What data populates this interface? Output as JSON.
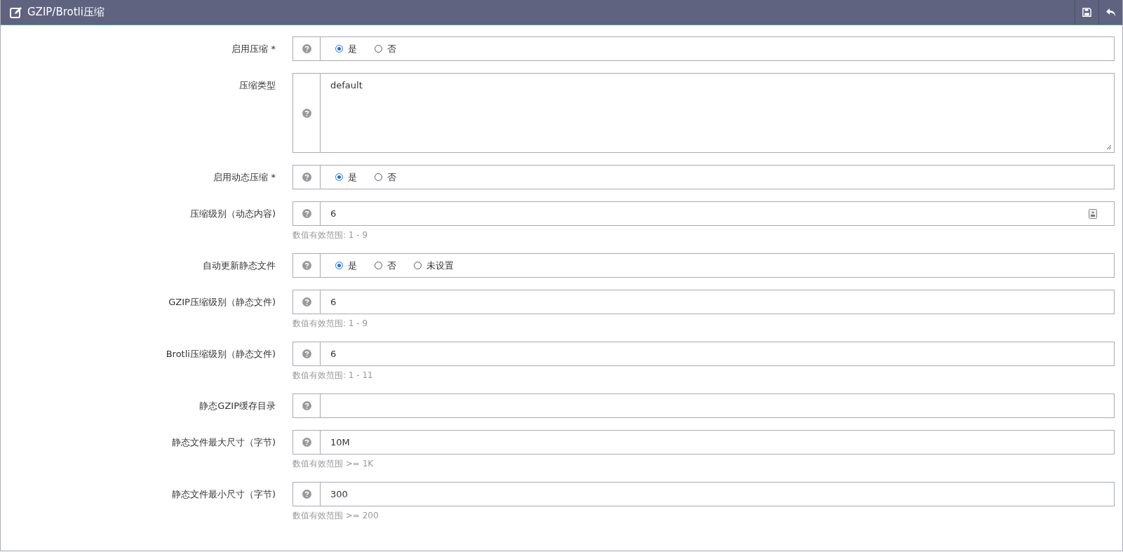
{
  "panel": {
    "title": "GZIP/Brotli压缩"
  },
  "fields": [
    {
      "kind": "radio",
      "label": "启用压缩 *",
      "options": [
        {
          "label": "是",
          "selected": true
        },
        {
          "label": "否",
          "selected": false
        }
      ]
    },
    {
      "kind": "textarea",
      "label": "压缩类型",
      "value": "default"
    },
    {
      "kind": "radio",
      "label": "启用动态压缩 *",
      "options": [
        {
          "label": "是",
          "selected": true
        },
        {
          "label": "否",
          "selected": false
        }
      ]
    },
    {
      "kind": "text",
      "label": "压缩级别（动态内容)",
      "value": "6",
      "picker": true,
      "hint": "数值有效范围: 1 - 9"
    },
    {
      "kind": "radio",
      "label": "自动更新静态文件",
      "options": [
        {
          "label": "是",
          "selected": true
        },
        {
          "label": "否",
          "selected": false
        },
        {
          "label": "未设置",
          "selected": false
        }
      ]
    },
    {
      "kind": "text",
      "label": "GZIP压缩级别（静态文件)",
      "value": "6",
      "picker": false,
      "hint": "数值有效范围: 1 - 9"
    },
    {
      "kind": "text",
      "label": "Brotli压缩级别（静态文件)",
      "value": "6",
      "picker": false,
      "hint": "数值有效范围: 1 - 11"
    },
    {
      "kind": "text",
      "label": "静态GZIP缓存目录",
      "picker": false
    },
    {
      "kind": "text",
      "label": "静态文件最大尺寸（字节)",
      "value": "10M",
      "picker": false,
      "hint": "数值有效范围 >= 1K"
    },
    {
      "kind": "text",
      "label": "静态文件最小尺寸（字节)",
      "value": "300",
      "picker": false,
      "hint": "数值有效范围 >= 200"
    }
  ]
}
